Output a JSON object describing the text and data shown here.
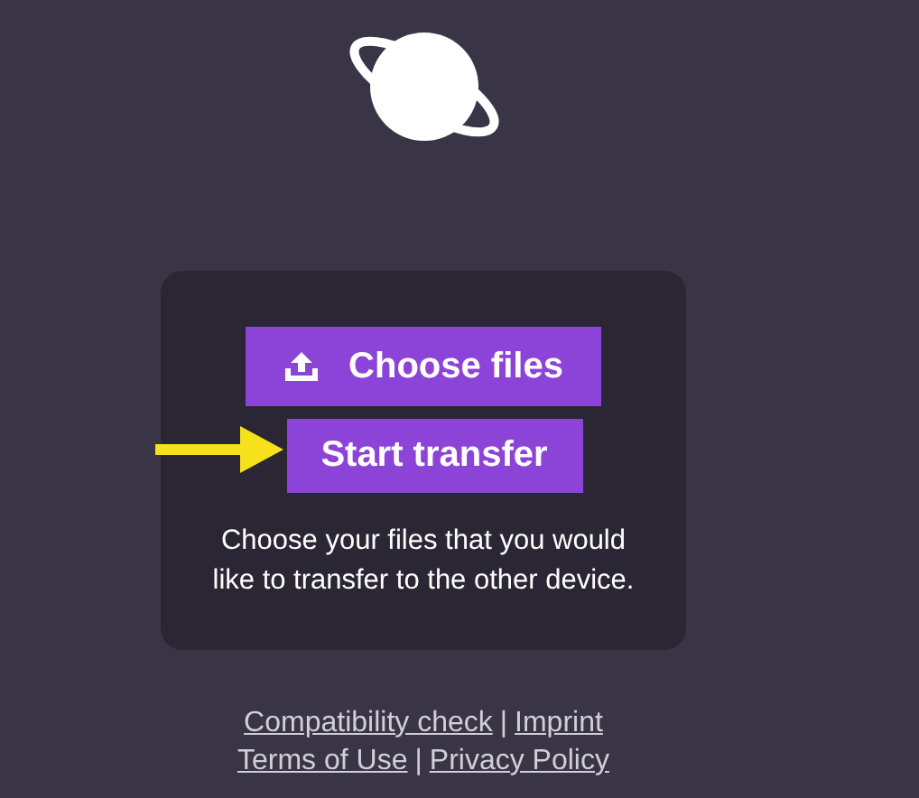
{
  "buttons": [
    {
      "kind": "upload",
      "label": "Choose files"
    },
    {
      "kind": "plain",
      "label": "Start transfer"
    }
  ],
  "description": "Choose your files that you would like to transfer to the other device.",
  "footer": {
    "lines": [
      [
        "Compatibility check",
        "Imprint"
      ],
      [
        "Terms of Use",
        "Privacy Policy"
      ]
    ],
    "separator": "|"
  }
}
